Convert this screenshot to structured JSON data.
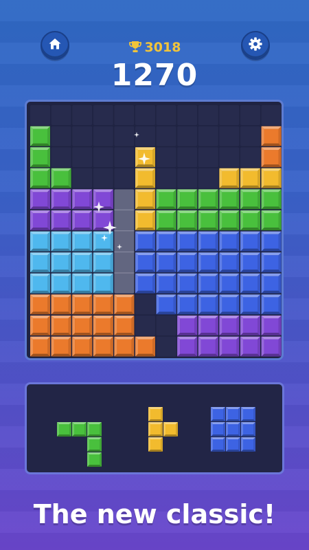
{
  "header": {
    "best_score": "3018",
    "score": "1270",
    "trophy_color": "#f1c43a"
  },
  "buttons": {
    "home_icon": "home-icon",
    "settings_icon": "gear-icon"
  },
  "colors": {
    "green": "#49c03d",
    "purple": "#8148d6",
    "cyan": "#4fb8ee",
    "blue": "#3d63e3",
    "orange": "#eb7a2c",
    "yellow": "#f2bb2e",
    "empty": "#272b4d",
    "preview": "#6d7189"
  },
  "board": {
    "columns": 12,
    "rows": 12,
    "cells": [
      "............",
      "G..........O",
      "G....Y.....O",
      "GG...Y...YYY",
      "PPPP.YGGGGGG",
      "PPPP.YGGGGGG",
      "CCCC.BBBBBBB",
      "CCCC.BBBBBBB",
      "CCCC.BBBBBBB",
      "OOOOO.BBBBBB",
      "OOOOO..PPPPP",
      "OOOOOO.PPPPP"
    ],
    "preview_column": 4,
    "preview_rows": [
      4,
      5,
      6,
      7,
      8
    ]
  },
  "tray": {
    "pieces": [
      {
        "color": "green",
        "shape": [
          "XXX",
          "..X",
          "..X"
        ]
      },
      {
        "color": "yellow",
        "shape": [
          "X.",
          "XX",
          "X."
        ]
      },
      {
        "color": "blue",
        "shape": [
          "XXX",
          "XXX",
          "XXX"
        ]
      }
    ]
  },
  "tagline": "The new classic!"
}
